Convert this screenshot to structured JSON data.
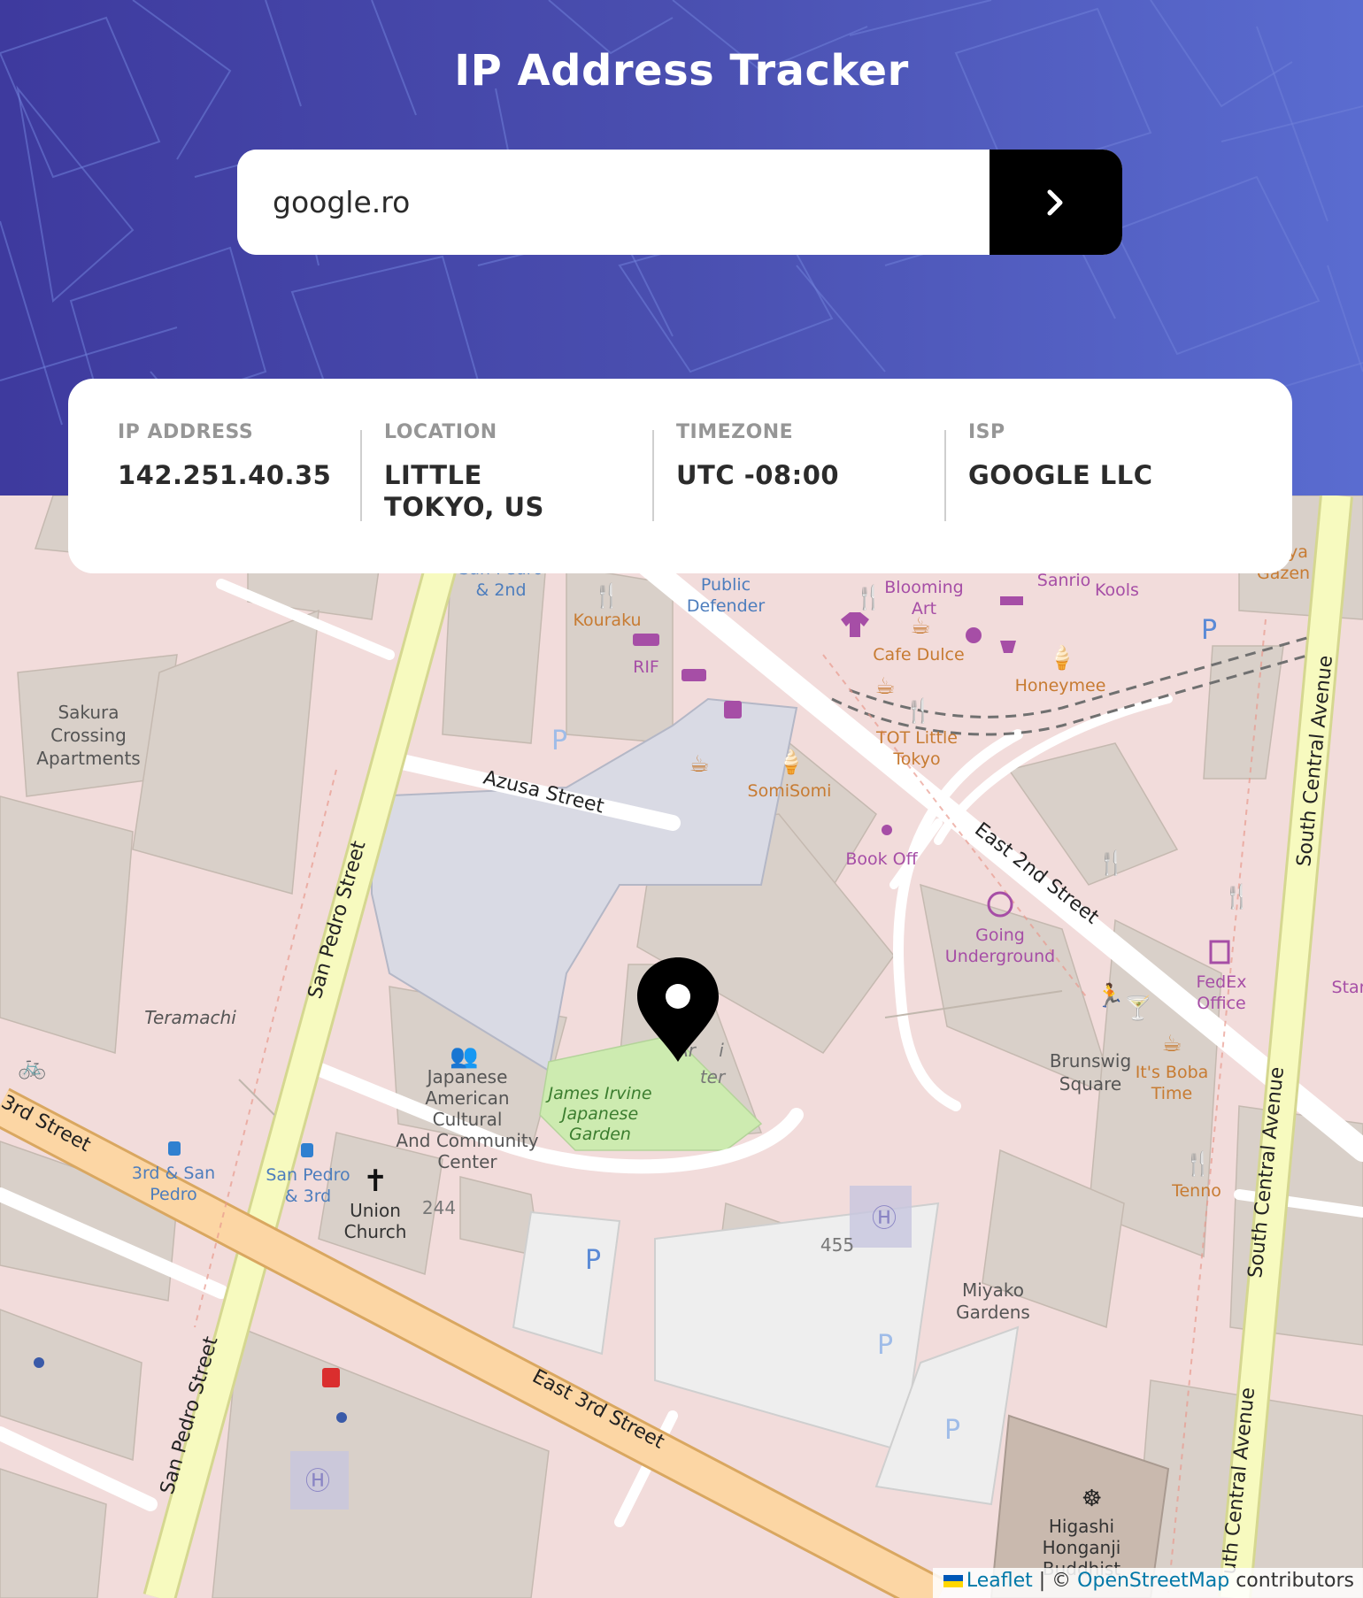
{
  "header": {
    "title": "IP Address Tracker",
    "search_value": "google.ro"
  },
  "info": {
    "ip_label": "IP ADDRESS",
    "ip_value": "142.251.40.35",
    "location_label": "LOCATION",
    "location_value_line1": "LITTLE",
    "location_value_line2": "TOKYO, US",
    "timezone_label": "TIMEZONE",
    "timezone_value": "UTC -08:00",
    "isp_label": "ISP",
    "isp_value": "GOOGLE LLC"
  },
  "map": {
    "streets": {
      "azusa": "Azusa Street",
      "san_pedro_1": "San Pedro Street",
      "san_pedro_2": "San Pedro Street",
      "east_2nd": "East 2nd Street",
      "east_3rd": "East 3rd Street",
      "third": "3rd Street",
      "south_central_1": "South Central Avenue",
      "south_central_2": "South Central Avenue",
      "south_central_3": "uth Central Avenue"
    },
    "places": {
      "sakura1": "Sakura",
      "sakura2": "Crossing",
      "sakura3": "Apartments",
      "teramachi": "Teramachi",
      "sanpedro2nd1": "San Pedro",
      "sanpedro2nd2": "& 2nd",
      "kouraku": "Kouraku",
      "rif": "RIF",
      "public1": "Public",
      "public2": "Defender",
      "blooming1": "Blooming",
      "blooming2": "Art",
      "sanrio": "Sanrio",
      "kools": "Kools",
      "cafedulce": "Cafe Dulce",
      "honeymee": "Honeymee",
      "tot1": "TOT Little",
      "tot2": "Tokyo",
      "somisomi": "SomiSomi",
      "bookoff": "Book Off",
      "going1": "Going",
      "going2": "Underground",
      "fedex1": "FedEx",
      "fedex2": "Office",
      "brunswig1": "Brunswig",
      "brunswig2": "Square",
      "boba1": "It's Boba",
      "boba2": "Time",
      "tenno": "Tenno",
      "jacc1": "Japanese",
      "jacc2": "American",
      "jacc3": "Cultural",
      "jacc4": "And Community",
      "jacc5": "Center",
      "garden1": "James Irvine",
      "garden2": "Japanese",
      "garden3": "Garden",
      "union1": "Union",
      "union2": "Church",
      "n244": "244",
      "n455": "455",
      "stop1a": "3rd & San",
      "stop1b": "Pedro",
      "stop2a": "San Pedro",
      "stop2b": "& 3rd",
      "miyako1": "Miyako",
      "miyako2": "Gardens",
      "higashi1": "Higashi",
      "higashi2": "Honganji",
      "higashi3": "Buddhist",
      "aya1": "ya",
      "aya2": "Gazen",
      "star": "Star",
      "ar": "Ar",
      "i": "i",
      "ter": "ter"
    }
  },
  "attribution": {
    "leaflet": "Leaflet",
    "sep": " | © ",
    "osm": "OpenStreetMap",
    "contrib": " contributors"
  }
}
